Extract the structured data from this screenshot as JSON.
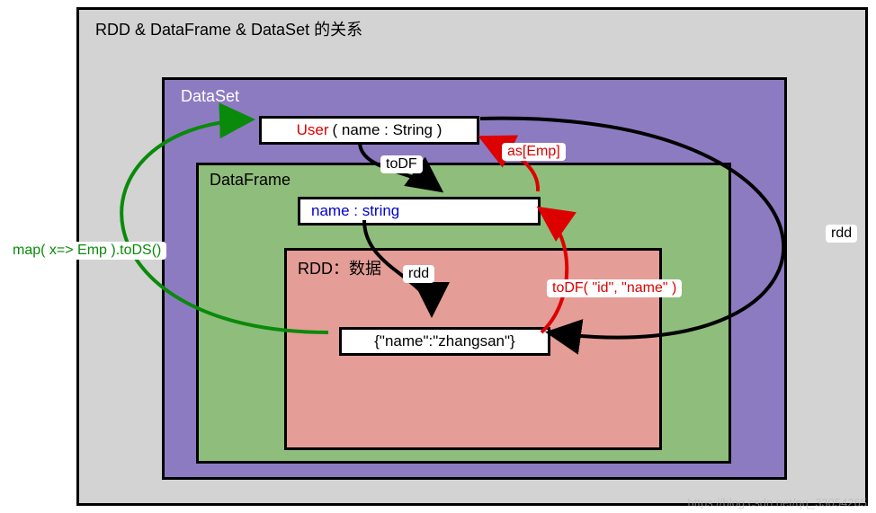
{
  "diagram": {
    "outer_title": "RDD & DataFrame & DataSet 的关系",
    "dataset": {
      "label": "DataSet",
      "user_class": "User",
      "user_args": "( name : String )"
    },
    "dataframe": {
      "label": "DataFrame",
      "fieldname": "name : string"
    },
    "rdd": {
      "label": "RDD：数据",
      "json_sample": "{\"name\":\"zhangsan\"}"
    }
  },
  "annotations": {
    "todf": "toDF",
    "as_emp": "as[Emp]",
    "rdd_down": "rdd",
    "todf_args": "toDF( \"id\", \"name\" )",
    "map_tods": "map( x=> Emp ).toDS()",
    "rdd_right": "rdd"
  },
  "watermark": "https://blog.csdn.net/qq_33054265"
}
